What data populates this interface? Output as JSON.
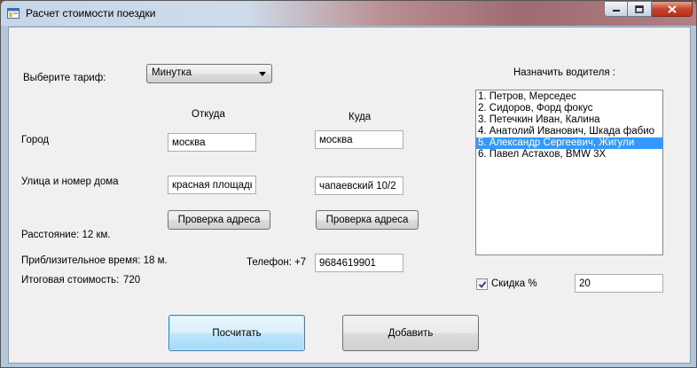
{
  "window": {
    "title": "Расчет стоимости поездки"
  },
  "tariff": {
    "label": "Выберите тариф:",
    "selected": "Минутка"
  },
  "columns": {
    "from": "Откуда",
    "to": "Куда"
  },
  "city": {
    "label": "Город",
    "from_value": "москва",
    "to_value": "москва"
  },
  "street": {
    "label": "Улица и номер дома",
    "from_value": "красная площадь",
    "to_value": "чапаевский 10/2"
  },
  "check_address": {
    "from_label": "Проверка адреса",
    "to_label": "Проверка адреса"
  },
  "distance": "Расстояние: 12 км.",
  "approx_time": "Приблизительное время: 18 м.",
  "total": {
    "label": "Итоговая стоимость:",
    "value": "720"
  },
  "phone": {
    "label": "Телефон:",
    "prefix": "+7",
    "value": "9684619901"
  },
  "driver": {
    "label": "Назначить водителя :",
    "items": [
      "1. Петров, Мерседес",
      "2. Сидоров, Форд фокус",
      "3. Петечкин Иван, Калина",
      "4. Анатолий Иванович, Шкада фабио",
      "5. Александр Сергеевич, Жигули",
      "6. Павел Астахов, BMW 3X"
    ],
    "selected_index": 4
  },
  "discount": {
    "label": "Скидка %",
    "checked": true,
    "value": "20"
  },
  "buttons": {
    "calculate": "Посчитать",
    "add": "Добавить"
  },
  "colors": {
    "selection": "#3399ff",
    "focus_button": "#a7d9f5"
  }
}
